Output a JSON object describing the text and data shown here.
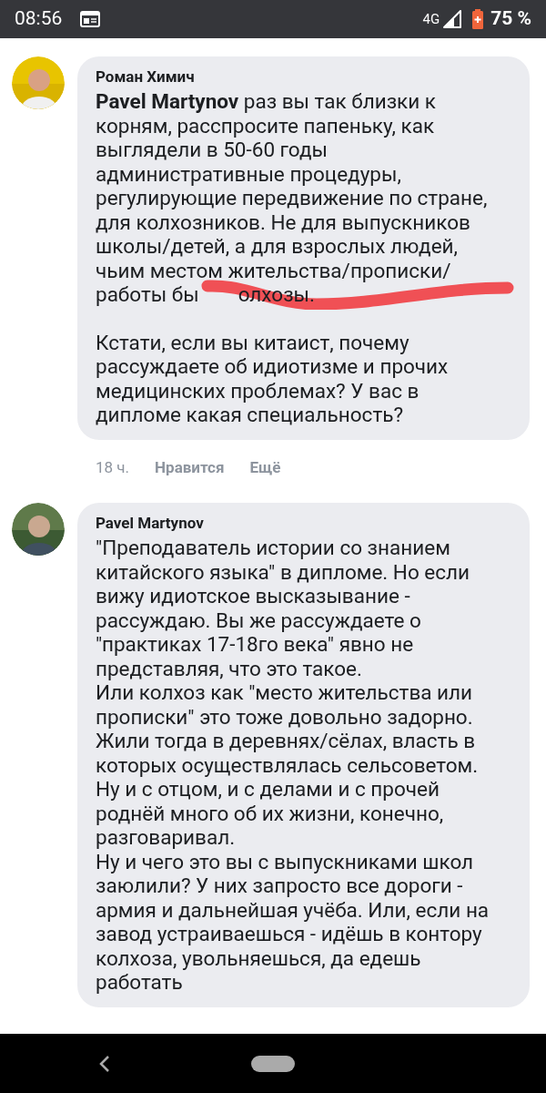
{
  "status_bar": {
    "time": "08:56",
    "network": "4G",
    "battery": "75 %"
  },
  "comments": [
    {
      "author": "Роман Химич",
      "paragraphs": [
        {
          "text": "**Pavel Martynov** раз вы так близки к корням, расспросите папеньку, как выглядели в 50-60 годы административные процедуры, регулирующие передвижение по стране, для колхозников. Не для выпускников школы/детей, а для взрослых людей, чьим местом жительства/прописки/",
          "before_scribble": "работы бы",
          "after_scribble": "олхозы."
        },
        {
          "text": "Кстати, если вы китаист, почему рассуждаете об идиотизме и прочих медицинских проблемах? У вас в дипломе какая специальность?"
        }
      ],
      "footer": {
        "time": "18 ч.",
        "like": "Нравится",
        "more": "Ещё"
      }
    },
    {
      "author": "Pavel Martynov",
      "paragraphs": [
        {
          "text": "\"Преподаватель истории со знанием китайского языка\" в дипломе. Но если вижу идиотское высказывание - рассуждаю. Вы же рассуждаете о \"практиках 17-18го века\" явно не представляя, что это такое.\nИли колхоз как \"место жительства или прописки\" это тоже довольно задорно. Жили тогда в деревнях/сёлах, власть в которых осуществлялась сельсоветом. Ну и с отцом, и с делами и с прочей роднёй много об их жизни, конечно, разговаривал.\nНу и чего это вы с выпускниками школ заюлили? У них запросто все дороги - армия и дальнейшая учёба. Или, если на завод устраиваешься - идёшь в контору колхоза, увольняешься, да едешь работать"
        }
      ]
    }
  ]
}
